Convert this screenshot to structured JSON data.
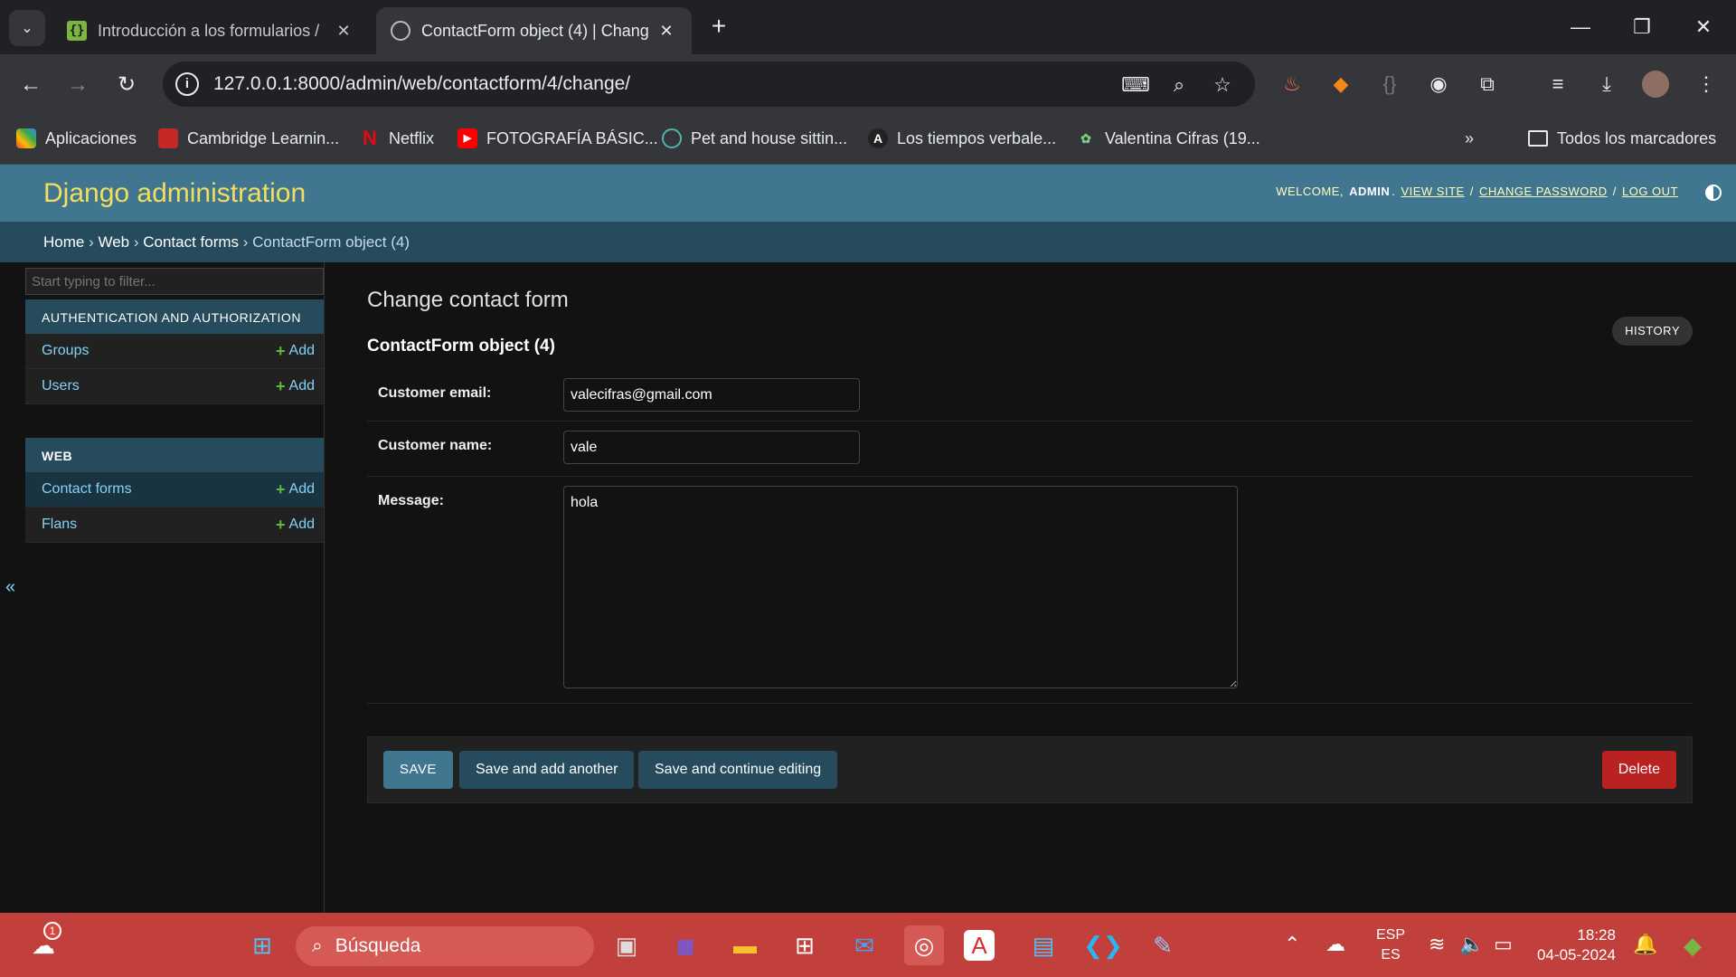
{
  "browser": {
    "tabs": [
      {
        "title": "Introducción a los formularios /",
        "favicon": "django-docs-icon"
      },
      {
        "title": "ContactForm object (4) | Chang",
        "favicon": "globe-icon"
      }
    ],
    "url": "127.0.0.1:8000/admin/web/contactform/4/change/",
    "bookmarks": [
      {
        "label": "Aplicaciones",
        "icon": "apps-grid-icon"
      },
      {
        "label": "Cambridge Learnin...",
        "icon": "cambridge-icon"
      },
      {
        "label": "Netflix",
        "icon": "netflix-icon"
      },
      {
        "label": "FOTOGRAFÍA BÁSIC...",
        "icon": "youtube-icon"
      },
      {
        "label": "Pet and house sittin...",
        "icon": "pet-icon"
      },
      {
        "label": "Los tiempos verbale...",
        "icon": "letter-a-icon"
      },
      {
        "label": "Valentina Cifras (19...",
        "icon": "plant-icon"
      }
    ],
    "all_bookmarks": "Todos los marcadores"
  },
  "django": {
    "brand": "Django administration",
    "welcome": "WELCOME,",
    "user": "ADMIN",
    "view_site": "VIEW SITE",
    "change_password": "CHANGE PASSWORD",
    "log_out": "LOG OUT",
    "breadcrumbs": {
      "home": "Home",
      "app": "Web",
      "model": "Contact forms",
      "current": "ContactForm object (4)"
    }
  },
  "sidebar": {
    "filter_placeholder": "Start typing to filter...",
    "modules": [
      {
        "caption": "AUTHENTICATION AND AUTHORIZATION",
        "items": [
          {
            "label": "Groups",
            "add": "Add"
          },
          {
            "label": "Users",
            "add": "Add"
          }
        ]
      },
      {
        "caption": "WEB",
        "items": [
          {
            "label": "Contact forms",
            "add": "Add"
          },
          {
            "label": "Flans",
            "add": "Add"
          }
        ]
      }
    ],
    "collapse": "«"
  },
  "content": {
    "title": "Change contact form",
    "history": "HISTORY",
    "object": "ContactForm object (4)",
    "fields": {
      "email_label": "Customer email:",
      "email_value": "valecifras@gmail.com",
      "name_label": "Customer name:",
      "name_value": "vale",
      "message_label": "Message:",
      "message_value": "hola"
    },
    "buttons": {
      "save": "SAVE",
      "save_add": "Save and add another",
      "save_continue": "Save and continue editing",
      "delete": "Delete"
    }
  },
  "taskbar": {
    "search": "Búsqueda",
    "weather_badge": "1",
    "lang1": "ESP",
    "lang2": "ES",
    "time": "18:28",
    "date": "04-05-2024"
  }
}
